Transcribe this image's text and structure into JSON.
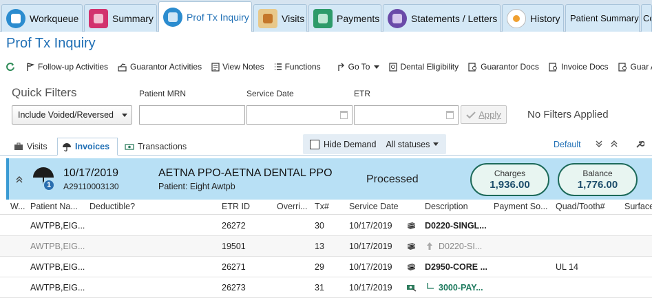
{
  "tabs": [
    {
      "label": "Workqueue",
      "icon": "workqueue-icon",
      "color": "#2b8ccf"
    },
    {
      "label": "Summary",
      "icon": "summary-icon",
      "color": "#d2326e"
    },
    {
      "label": "Prof Tx Inquiry",
      "icon": "prof-tx-icon",
      "color": "#2b8ccf"
    },
    {
      "label": "Visits",
      "icon": "visits-icon",
      "color": "#e0a030"
    },
    {
      "label": "Payments",
      "icon": "payments-icon",
      "color": "#2e9b6a"
    },
    {
      "label": "Statements / Letters",
      "icon": "statements-icon",
      "color": "#6a4aa8"
    },
    {
      "label": "History",
      "icon": "history-icon",
      "color": "#e8e8e8"
    },
    {
      "label": "Patient Summary"
    },
    {
      "label": "Co"
    }
  ],
  "page_title": "Prof Tx Inquiry",
  "toolbar": {
    "refresh": "",
    "followup": "Follow-up Activities",
    "guarantor_activities": "Guarantor Activities",
    "view_notes": "View Notes",
    "functions": "Functions",
    "goto": "Go To",
    "dental_elig": "Dental Eligibility",
    "guarantor_docs": "Guarantor Docs",
    "invoice_docs": "Invoice Docs",
    "guar_a": "Guar A"
  },
  "filters": {
    "title": "Quick Filters",
    "select_value": "Include Voided/Reversed",
    "mrn_label": "Patient MRN",
    "service_date_label": "Service Date",
    "etr_label": "ETR",
    "apply": "Apply",
    "status": "No Filters Applied"
  },
  "subtabs": {
    "visits": "Visits",
    "invoices": "Invoices",
    "transactions": "Transactions"
  },
  "hide_demand": "Hide Demand",
  "all_statuses": "All statuses",
  "default_link": "Default",
  "invoice": {
    "date": "10/17/2019",
    "number": "A29110003130",
    "payer": "AETNA PPO-AETNA DENTAL PPO",
    "patient": "Patient: Eight Awtpb",
    "status": "Processed",
    "badge": "1",
    "charges_label": "Charges",
    "charges": "1,936.00",
    "balance_label": "Balance",
    "balance": "1,776.00"
  },
  "columns": [
    "W...",
    "Patient Na...",
    "Deductible?",
    "ETR ID",
    "Overri...",
    "Tx#",
    "Service Date",
    "Description",
    "Payment So...",
    "Quad/Tooth#",
    "Surface"
  ],
  "rows": [
    {
      "patient": "AWTPB,EIG...",
      "etr": "26272",
      "tx": "30",
      "date": "10/17/2019",
      "desc": "D0220-SINGL...",
      "quad": "",
      "style": "normal"
    },
    {
      "patient": "AWTPB,EIG...",
      "etr": "19501",
      "tx": "13",
      "date": "10/17/2019",
      "desc": "D0220-SI...",
      "quad": "",
      "style": "grey"
    },
    {
      "patient": "AWTPB,EIG...",
      "etr": "26271",
      "tx": "29",
      "date": "10/17/2019",
      "desc": "D2950-CORE ...",
      "quad": "UL 14",
      "style": "normal"
    },
    {
      "patient": "AWTPB,EIG...",
      "etr": "26273",
      "tx": "31",
      "date": "10/17/2019",
      "desc": "3000-PAY...",
      "quad": "",
      "style": "green"
    }
  ]
}
